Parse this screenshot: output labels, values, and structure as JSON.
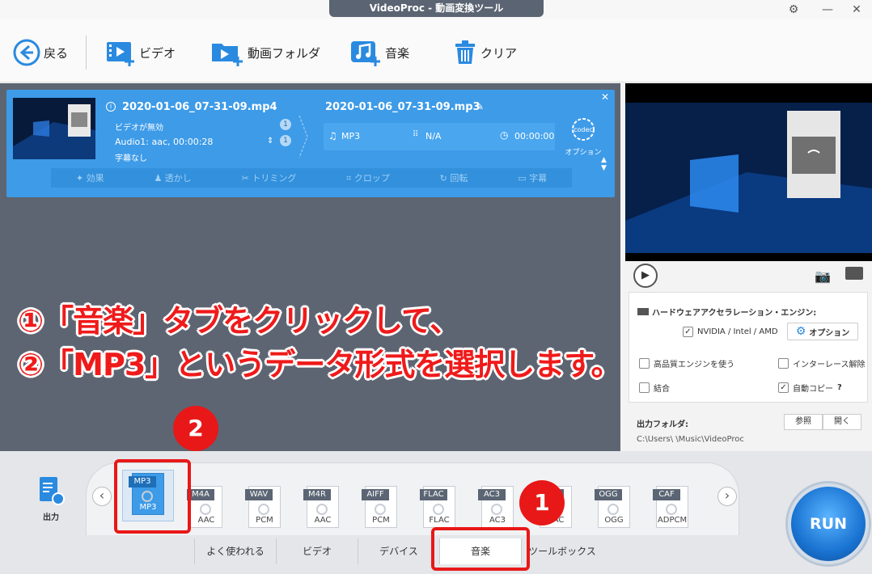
{
  "window": {
    "title": "VideoProc - 動画変換ツール"
  },
  "toolbar": {
    "back": "戻る",
    "video": "ビデオ",
    "video_folder": "動画フォルダ",
    "music": "音楽",
    "clear": "クリア"
  },
  "file": {
    "input_name": "2020-01-06_07-31-09.mp4",
    "output_name": "2020-01-06_07-31-09.mp3",
    "video_state": "ビデオが無効",
    "audio_track": "Audio1: aac, 00:00:28",
    "subtitle": "字幕なし",
    "track_count_1": "1",
    "track_count_2": "1",
    "out_format": "MP3",
    "out_resolution": "N/A",
    "out_duration": "00:00:00",
    "codec_label": "codec",
    "option_label": "オプション",
    "edit": {
      "effect": "効果",
      "watermark": "透かし",
      "trim": "トリミング",
      "crop": "クロップ",
      "rotate": "回転",
      "subtitle": "字幕"
    }
  },
  "settings": {
    "hw_accel_title": "ハードウェアアクセラレーション・エンジン:",
    "hw_vendor": "NVIDIA / Intel / AMD",
    "option_button": "オプション",
    "hq_engine": "高品質エンジンを使う",
    "deinterlace": "インターレース解除",
    "merge": "結合",
    "autocopy": "自動コピー",
    "help_mark": "?",
    "output_folder_label": "出力フォルダ:",
    "browse": "参照",
    "open": "開く",
    "output_path": "C:\\Users\\        \\Music\\VideoProc"
  },
  "formats": [
    {
      "tag": "MP3",
      "sub": "MP3",
      "selected": true
    },
    {
      "tag": "M4A",
      "sub": "AAC"
    },
    {
      "tag": "WAV",
      "sub": "PCM"
    },
    {
      "tag": "M4R",
      "sub": "AAC"
    },
    {
      "tag": "AIFF",
      "sub": "PCM"
    },
    {
      "tag": "FLAC",
      "sub": "FLAC"
    },
    {
      "tag": "AC3",
      "sub": "AC3"
    },
    {
      "tag": "AAC",
      "sub": "AAC"
    },
    {
      "tag": "OGG",
      "sub": "OGG"
    },
    {
      "tag": "CAF",
      "sub": "ADPCM"
    }
  ],
  "output_side_label": "出力",
  "tabs": [
    "よく使われる",
    "ビデオ",
    "デバイス",
    "音楽",
    "ツールボックス"
  ],
  "active_tab": "音楽",
  "run_label": "RUN",
  "annotation": {
    "line1": "①「音楽」タブをクリックして、",
    "line2": "②「MP3」というデータ形式を選択します。",
    "num1": "1",
    "num2": "2"
  },
  "colors": {
    "accent": "#3d9be8",
    "annotation_red": "#e81818",
    "workspace": "#5d6572"
  }
}
